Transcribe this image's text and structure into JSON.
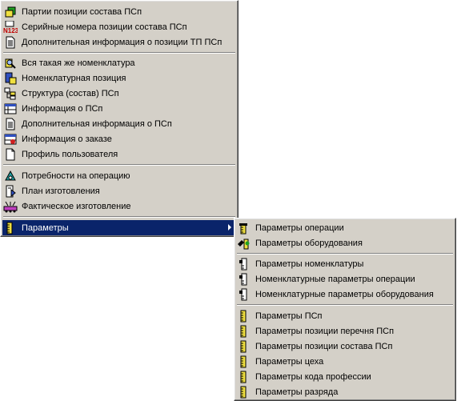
{
  "main_menu": {
    "items": [
      {
        "label": "Партии позиции состава ПСп",
        "icon": "lots-icon"
      },
      {
        "label": "Серийные номера позиции состава ПСп",
        "icon": "serial-number-icon"
      },
      {
        "label": "Дополнительная информация о позиции ТП ПСп",
        "icon": "document-icon"
      },
      {
        "label": "Вся такая же номенклатура",
        "icon": "same-nomenclature-icon"
      },
      {
        "label": "Номенклатурная позиция",
        "icon": "nomenclature-item-icon"
      },
      {
        "label": "Структура (состав) ПСп",
        "icon": "structure-icon"
      },
      {
        "label": "Информация о ПСп",
        "icon": "info-table-icon"
      },
      {
        "label": "Дополнительная информация о ПСп",
        "icon": "document-icon"
      },
      {
        "label": "Информация о заказе",
        "icon": "order-info-icon"
      },
      {
        "label": "Профиль пользователя",
        "icon": "blank-page-icon"
      },
      {
        "label": "Потребности на операцию",
        "icon": "operation-needs-icon"
      },
      {
        "label": "План изготовления",
        "icon": "production-plan-icon"
      },
      {
        "label": "Фактическое изготовление",
        "icon": "actual-production-icon"
      },
      {
        "label": "Параметры",
        "icon": "parameters-icon"
      }
    ]
  },
  "sub_menu": {
    "items": [
      {
        "label": "Параметры операции",
        "icon": "parameters-icon"
      },
      {
        "label": "Параметры оборудования",
        "icon": "equipment-parameters-icon"
      },
      {
        "label": "Параметры номенклатуры",
        "icon": "nomenclature-parameters-icon"
      },
      {
        "label": "Номенклатурные параметры операции",
        "icon": "nomenclature-parameters-icon"
      },
      {
        "label": "Номенклатурные параметры оборудования",
        "icon": "nomenclature-parameters-icon"
      },
      {
        "label": "Параметры ПСп",
        "icon": "parameters-icon"
      },
      {
        "label": "Параметры позиции перечня ПСп",
        "icon": "parameters-icon"
      },
      {
        "label": "Параметры позиции состава ПСп",
        "icon": "parameters-icon"
      },
      {
        "label": "Параметры цеха",
        "icon": "parameters-icon"
      },
      {
        "label": "Параметры кода профессии",
        "icon": "parameters-icon"
      },
      {
        "label": "Параметры разряда",
        "icon": "parameters-icon"
      }
    ]
  },
  "colors": {
    "menu_bg": "#d4d0c8",
    "highlight": "#0a246a",
    "highlight_text": "#ffffff"
  }
}
